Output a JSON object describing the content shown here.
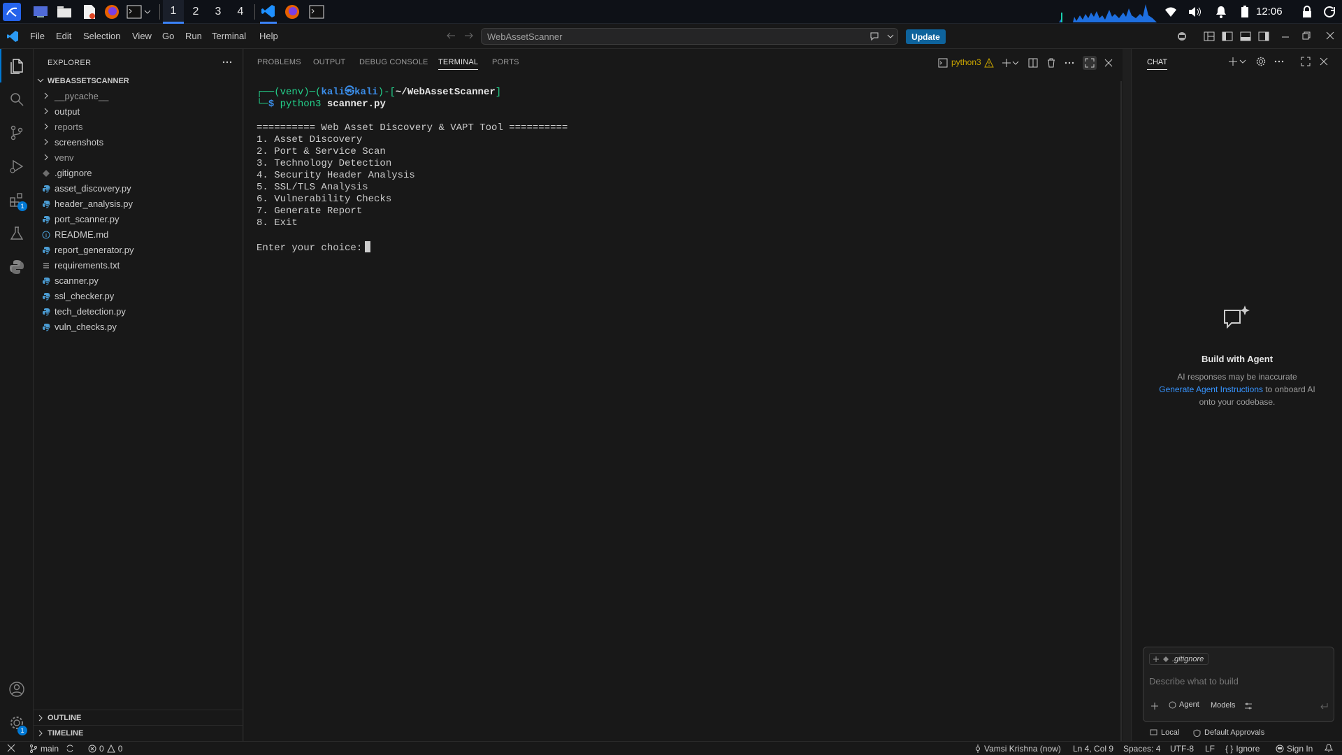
{
  "taskbar": {
    "workspaces": [
      "1",
      "2",
      "3",
      "4"
    ],
    "active_workspace": "1",
    "clock": "12:06"
  },
  "menubar": {
    "items": [
      "File",
      "Edit",
      "Selection",
      "View",
      "Go",
      "Run",
      "Terminal",
      "Help"
    ],
    "search_text": "WebAssetScanner",
    "update_label": "Update"
  },
  "explorer": {
    "title": "EXPLORER",
    "root": "WEBASSETSCANNER",
    "folders": [
      "__pycache__",
      "output",
      "reports",
      "screenshots",
      "venv"
    ],
    "files": [
      ".gitignore",
      "asset_discovery.py",
      "header_analysis.py",
      "port_scanner.py",
      "README.md",
      "report_generator.py",
      "requirements.txt",
      "scanner.py",
      "ssl_checker.py",
      "tech_detection.py",
      "vuln_checks.py"
    ],
    "outline_label": "OUTLINE",
    "timeline_label": "TIMELINE"
  },
  "panel": {
    "tabs": [
      "PROBLEMS",
      "OUTPUT",
      "DEBUG CONSOLE",
      "TERMINAL",
      "PORTS"
    ],
    "active_tab": "TERMINAL",
    "terminal_name": "python3"
  },
  "terminal": {
    "prompt_venv": "(venv)",
    "prompt_user": "kali",
    "prompt_host": "kali",
    "prompt_path": "~/WebAssetScanner",
    "command_bin": "python3",
    "command_arg": "scanner.py",
    "banner": "========== Web Asset Discovery & VAPT Tool ==========",
    "menu": [
      "1. Asset Discovery",
      "2. Port & Service Scan",
      "3. Technology Detection",
      "4. Security Header Analysis",
      "5. SSL/TLS Analysis",
      "6. Vulnerability Checks",
      "7. Generate Report",
      "8. Exit"
    ],
    "input_prompt": "Enter your choice:"
  },
  "chat": {
    "title": "CHAT",
    "heading": "Build with Agent",
    "line1": "AI responses may be inaccurate",
    "link": "Generate Agent Instructions",
    "line2_tail": " to onboard AI",
    "line3": "onto your codebase.",
    "context_file": ".gitignore",
    "input_placeholder": "Describe what to build",
    "agent_label": "Agent",
    "models_label": "Models",
    "local_label": "Local",
    "approvals_label": "Default Approvals"
  },
  "statusbar": {
    "branch": "main",
    "errors": "0",
    "warnings": "0",
    "blame": "Vamsi Krishna (now)",
    "position": "Ln 4, Col 9",
    "spaces": "Spaces: 4",
    "encoding": "UTF-8",
    "eol": "LF",
    "language": "Ignore",
    "signin": "Sign In"
  },
  "colors": {
    "accent": "#0078d4",
    "update_button": "#0e639c",
    "terminal_green": "#23d18b",
    "terminal_blue": "#3b8eea"
  }
}
